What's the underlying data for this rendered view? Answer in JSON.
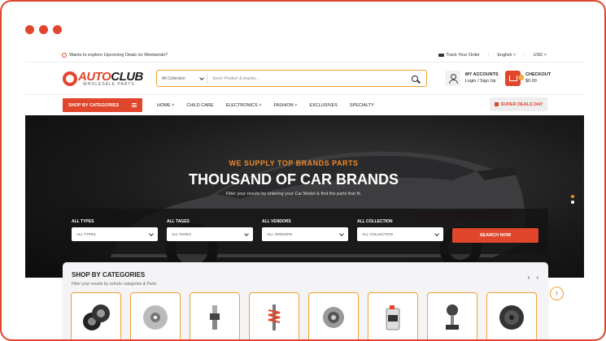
{
  "window": {
    "controls": [
      "close",
      "minimize",
      "maximize"
    ]
  },
  "topbar": {
    "promo": "Wants to explore Upcoming Deals on Weekends?",
    "track": "Track Your Order",
    "language": "English",
    "currency": "USD"
  },
  "header": {
    "logo_main_a": "AUTO",
    "logo_main_b": "CLUB",
    "logo_sub": "WHOLESALE PARTS",
    "search": {
      "collection": "All Collection",
      "placeholder": "Serch Product & brands..."
    },
    "account": {
      "title": "MY ACCOUNTS",
      "subtitle": "Login / Sign Up"
    },
    "checkout": {
      "title": "CHECKOUT",
      "amount": "$0.00",
      "count": "0"
    }
  },
  "nav": {
    "categories_button": "SHOP BY CATEGORIES",
    "items": [
      "HOME",
      "CHILD CARE",
      "ELECTRONICS",
      "FASHION",
      "EXCLUSIVES",
      "SPECIALTY"
    ],
    "deals": "SUPER DEALS DAY"
  },
  "hero": {
    "tagline": "WE SUPPLY TOP BRANDS PARTS",
    "title": "THOUSAND OF CAR BRANDS",
    "description": "Filter your results by entering your Car Model & find the parts that fit.",
    "filters": [
      {
        "label": "ALL TYPES",
        "value": "ALL TYPES"
      },
      {
        "label": "ALL TAGES",
        "value": "ALL TAGES"
      },
      {
        "label": "ALL VENDORS",
        "value": "ALL VENDORS"
      },
      {
        "label": "ALL COLLECTION",
        "value": "ALL COLLECTION"
      }
    ],
    "search_button": "SEARCH NOW"
  },
  "shop": {
    "title": "SHOP BY CATEGORIES",
    "subtitle": "Filter your results by vehicle categories & Parts",
    "categories": [
      "tires-icon",
      "brake-disc-icon",
      "spark-plug-icon",
      "shock-absorber-icon",
      "turbo-icon",
      "oil-bottle-icon",
      "gear-shift-icon",
      "speaker-icon"
    ]
  },
  "colors": {
    "accent": "#e0462c",
    "secondary": "#f0a030",
    "dark": "#1a1a1a"
  }
}
